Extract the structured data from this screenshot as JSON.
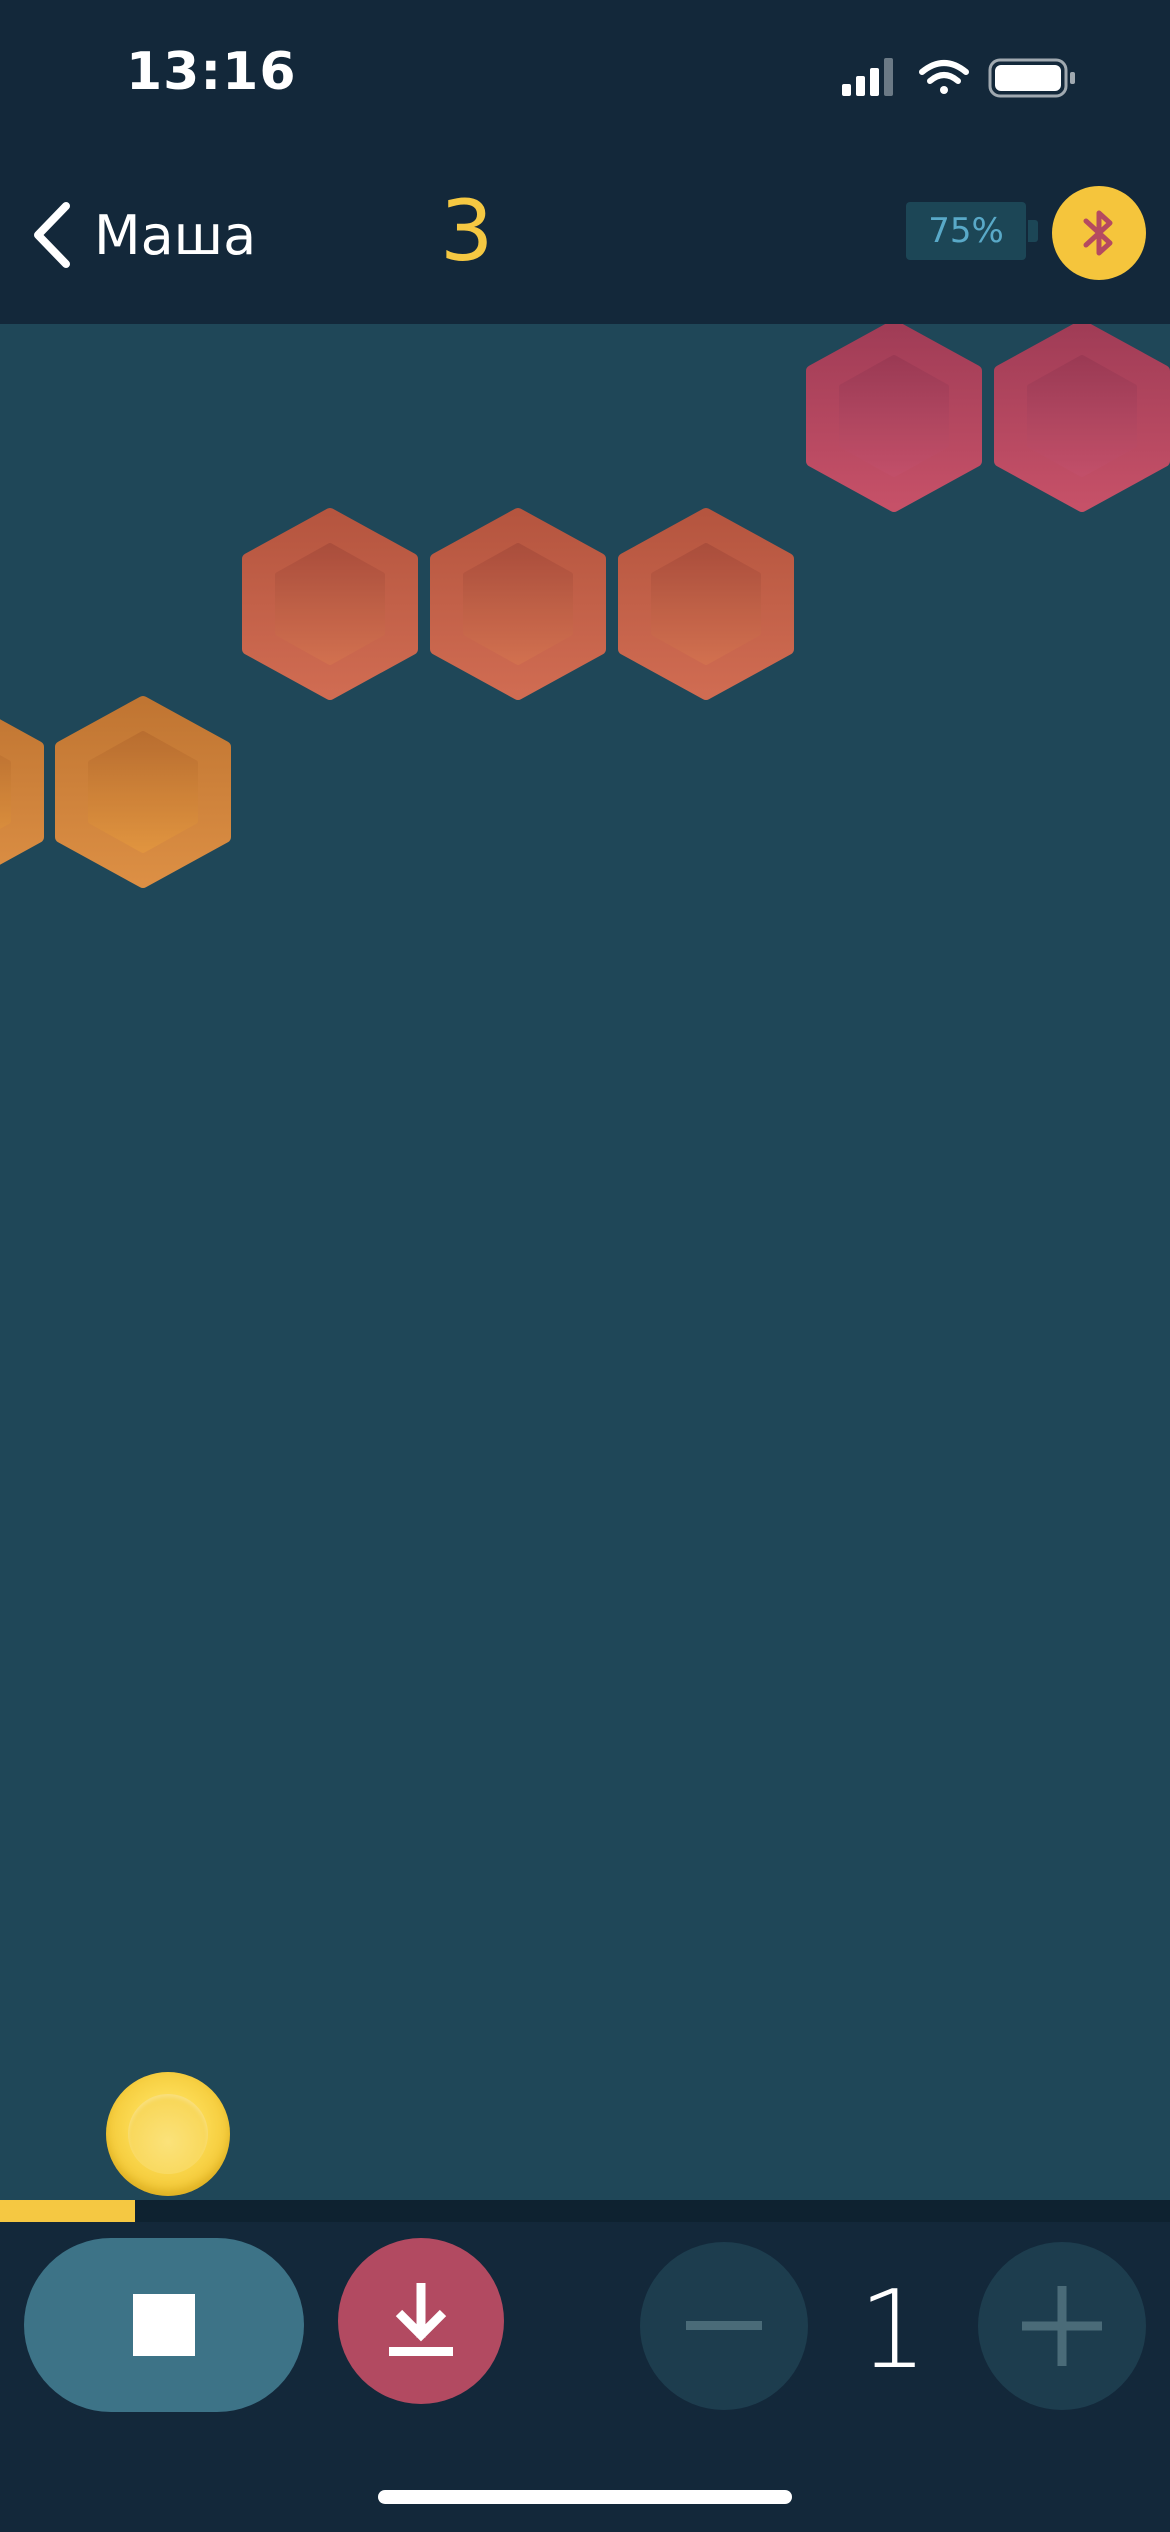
{
  "status_bar": {
    "time": "13:16",
    "icons": [
      "cellular-signal-icon",
      "wifi-icon",
      "battery-icon"
    ]
  },
  "header": {
    "back_label": "Маша",
    "score": "3",
    "robot_battery": "75%",
    "bluetooth_icon": "bluetooth-icon"
  },
  "colors": {
    "background": "#13283a",
    "playfield": "#1f4758",
    "accent_yellow": "#f5c842",
    "pink_hex": "#b44a60",
    "red_orange_hex": "#c2634d",
    "orange_hex": "#cd853e",
    "stop_button": "#3d7387",
    "download_button": "#b24a61"
  },
  "playfield": {
    "rows": [
      {
        "color_name": "pink",
        "count_visible": 2
      },
      {
        "color_name": "red-orange",
        "count_visible": 3
      },
      {
        "color_name": "orange",
        "count_visible": 2
      }
    ]
  },
  "progress": {
    "fraction": 0.115
  },
  "controls": {
    "stop_icon": "stop-icon",
    "download_icon": "download-icon",
    "minus_icon": "minus-icon",
    "plus_icon": "plus-icon",
    "count": "1"
  }
}
